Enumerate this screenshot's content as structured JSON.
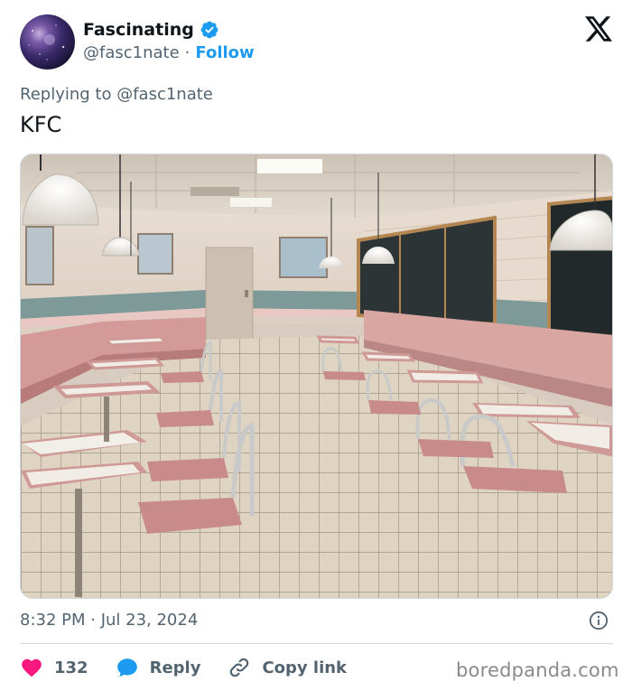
{
  "author": {
    "name": "Fascinating",
    "handle": "@fasc1nate",
    "separator": "·",
    "follow_label": "Follow"
  },
  "replying_to": "Replying to @fasc1nate",
  "tweet_text": "KFC",
  "timestamp": "8:32 PM · Jul 23, 2024",
  "actions": {
    "likes_count": "132",
    "reply_label": "Reply",
    "copy_link_label": "Copy link"
  },
  "icons": {
    "verified": "verified-badge-icon",
    "x_logo": "x-logo-icon",
    "info": "info-icon",
    "heart": "heart-icon",
    "reply": "speech-bubble-icon",
    "link": "link-icon"
  },
  "colors": {
    "accent": "#1d9bf0",
    "heart": "#f91880",
    "muted": "#536471",
    "text": "#0f1419"
  },
  "watermark": "boredpanda.com"
}
